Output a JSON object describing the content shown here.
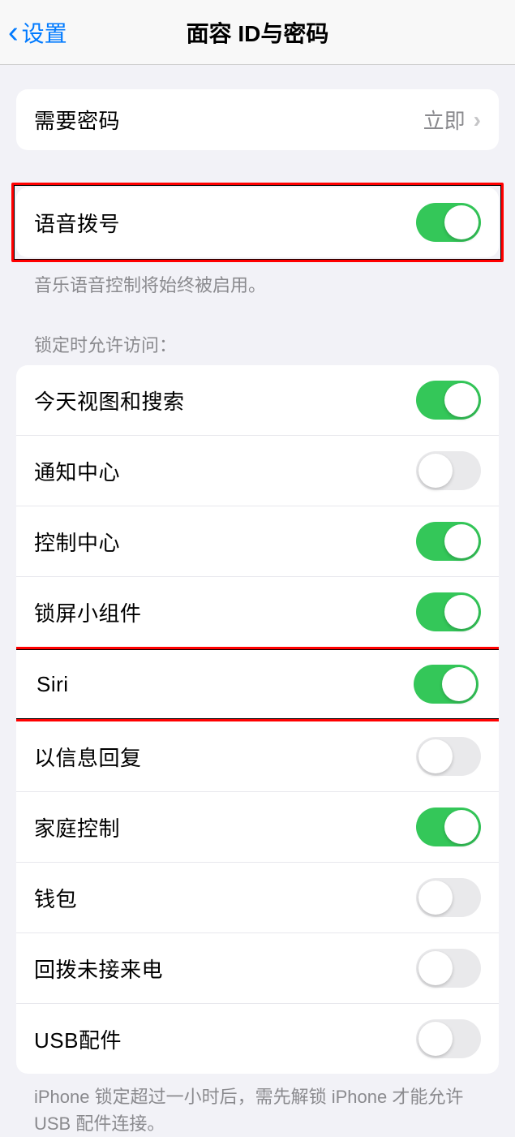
{
  "header": {
    "back_label": "设置",
    "title": "面容 ID与密码"
  },
  "require_passcode": {
    "label": "需要密码",
    "value": "立即"
  },
  "voice_dial": {
    "label": "语音拨号",
    "on": true,
    "footer": "音乐语音控制将始终被启用。"
  },
  "allow_access_header": "锁定时允许访问：",
  "allow_access": [
    {
      "label": "今天视图和搜索",
      "on": true
    },
    {
      "label": "通知中心",
      "on": false
    },
    {
      "label": "控制中心",
      "on": true
    },
    {
      "label": "锁屏小组件",
      "on": true
    },
    {
      "label": "Siri",
      "on": true,
      "highlighted": true
    },
    {
      "label": "以信息回复",
      "on": false
    },
    {
      "label": "家庭控制",
      "on": true
    },
    {
      "label": "钱包",
      "on": false
    },
    {
      "label": "回拨未接来电",
      "on": false
    },
    {
      "label": "USB配件",
      "on": false
    }
  ],
  "usb_footer": "iPhone 锁定超过一小时后，需先解锁 iPhone 才能允许 USB 配件连接。"
}
